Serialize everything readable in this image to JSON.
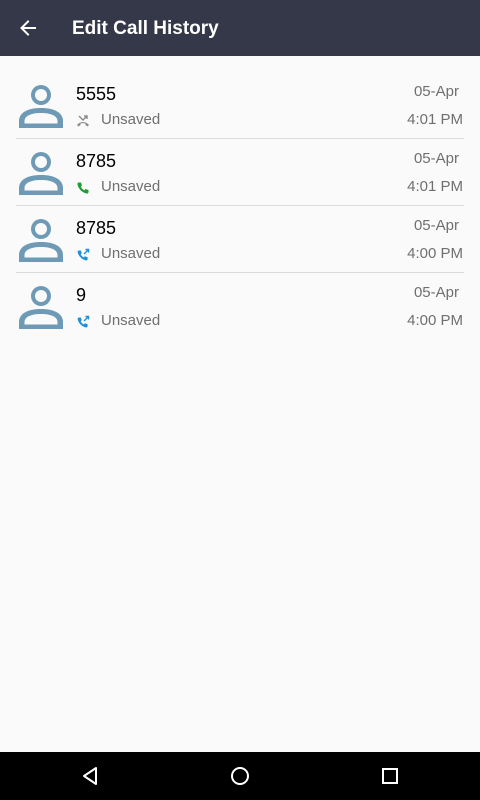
{
  "header": {
    "title": "Edit Call History",
    "back_icon": "arrow-back-icon"
  },
  "calls": [
    {
      "number": "5555",
      "status": "Unsaved",
      "date": "05-Apr",
      "time": "4:01 PM",
      "call_type": "missed",
      "icon": "missed-call-icon",
      "icon_color": "#8a8a8a"
    },
    {
      "number": "8785",
      "status": "Unsaved",
      "date": "05-Apr",
      "time": "4:01 PM",
      "call_type": "incoming",
      "icon": "incoming-call-icon",
      "icon_color": "#1e9e34"
    },
    {
      "number": "8785",
      "status": "Unsaved",
      "date": "05-Apr",
      "time": "4:00 PM",
      "call_type": "outgoing",
      "icon": "outgoing-call-icon",
      "icon_color": "#1f8fd8"
    },
    {
      "number": "9",
      "status": "Unsaved",
      "date": "05-Apr",
      "time": "4:00 PM",
      "call_type": "outgoing",
      "icon": "outgoing-call-icon",
      "icon_color": "#1f8fd8"
    }
  ],
  "navigation": {
    "back_icon": "nav-back-icon",
    "home_icon": "nav-home-icon",
    "recents_icon": "nav-recents-icon"
  },
  "colors": {
    "app_bar": "#353849",
    "avatar": "#6f9ab6",
    "background": "#fafafa"
  }
}
